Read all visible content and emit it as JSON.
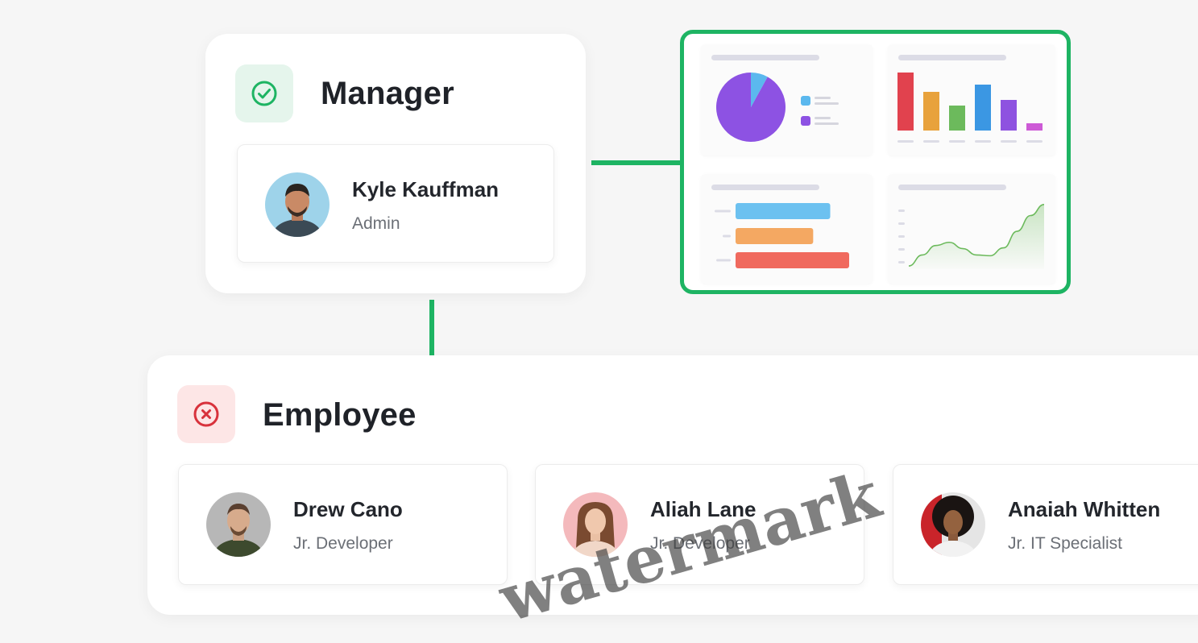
{
  "manager": {
    "title": "Manager",
    "status_icon": "check-circle-icon",
    "person": {
      "name": "Kyle Kauffman",
      "role": "Admin"
    }
  },
  "employee": {
    "title": "Employee",
    "status_icon": "x-circle-icon",
    "people": [
      {
        "name": "Drew Cano",
        "role": "Jr. Developer"
      },
      {
        "name": "Aliah Lane",
        "role": "Jr. Developer"
      },
      {
        "name": "Anaiah Whitten",
        "role": "Jr. IT Specialist"
      }
    ]
  },
  "colors": {
    "connector": "#1eb463",
    "success_bg": "#e5f5ec",
    "success": "#1eb463",
    "danger_bg": "#fde6e6",
    "danger": "#d8323c"
  },
  "watermark": "watermark",
  "chart_data": [
    {
      "type": "pie",
      "values": [
        92,
        8
      ],
      "colors": [
        "#8d52e3",
        "#5bb8ee"
      ]
    },
    {
      "type": "bar",
      "categories": [
        "",
        "",
        "",
        "",
        "",
        ""
      ],
      "values": [
        72,
        48,
        31,
        57,
        38,
        9
      ],
      "colors": [
        "#e1424e",
        "#e8a23c",
        "#6cba5c",
        "#3b97e3",
        "#8e52e0",
        "#cd5ad6"
      ]
    },
    {
      "type": "bar",
      "orientation": "horizontal",
      "categories": [
        "",
        "",
        ""
      ],
      "values": [
        100,
        82,
        120
      ],
      "colors": [
        "#6cc1f0",
        "#f4a862",
        "#f06a5e"
      ]
    },
    {
      "type": "area",
      "x": [
        0,
        1,
        2,
        3,
        4,
        5,
        6,
        7,
        8,
        9,
        10
      ],
      "values": [
        4,
        18,
        30,
        34,
        26,
        18,
        17,
        27,
        48,
        68,
        82
      ],
      "color": "#6cba5c"
    }
  ]
}
